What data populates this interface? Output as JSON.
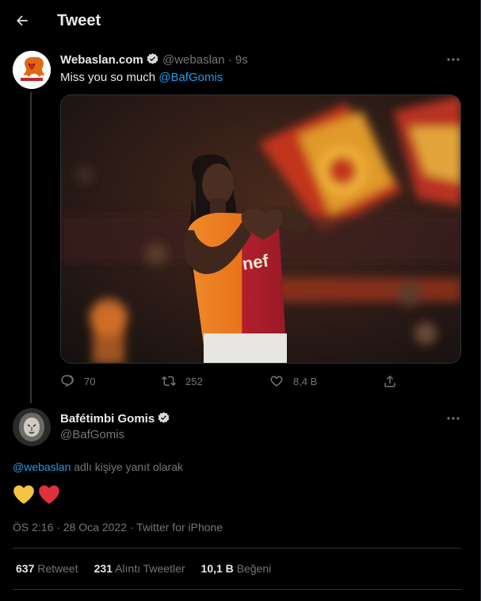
{
  "header": {
    "title": "Tweet"
  },
  "tweet1": {
    "name": "Webaslan.com",
    "handle_time": "@webaslan · 9s",
    "text_prefix": "Miss you so much ",
    "mention": "@BafGomis",
    "avatar_text": "webaslan.com",
    "actions": {
      "reply": "70",
      "retweet": "252",
      "like": "8,4 B"
    }
  },
  "tweet2": {
    "name": "Bafétimbi Gomis",
    "handle": "@BafGomis",
    "reply_mention": "@webaslan",
    "reply_suffix": " adlı kişiye yanıt olarak",
    "meta": "ÖS 2:16 · 28 Oca 2022 · Twitter for iPhone"
  },
  "stats": {
    "retweets_count": "637",
    "retweets_label": "Retweet",
    "quotes_count": "231",
    "quotes_label": "Alıntı Tweetler",
    "likes_count": "10,1 B",
    "likes_label": "Beğeni"
  },
  "colors": {
    "accent": "#1d9bf0",
    "background": "#000000",
    "text": "#e7e9ea",
    "muted": "#71767b",
    "jersey_orange": "#f07a1c",
    "jersey_red": "#b01f2a",
    "heart_yellow": "#f4c542",
    "heart_red": "#e0303e"
  }
}
